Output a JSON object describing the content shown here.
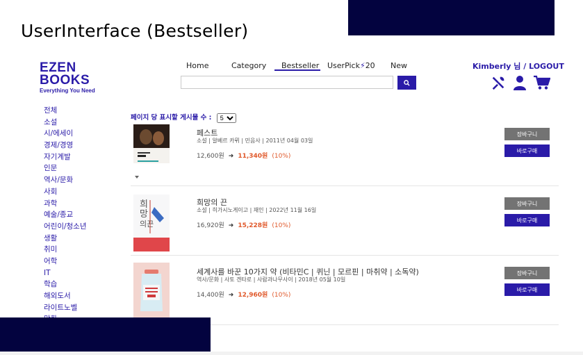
{
  "slide": {
    "title": "UserInterface (Bestseller)"
  },
  "logo": {
    "line1": "EZEN",
    "line2": "BOOKS",
    "tagline": "Everything You Need"
  },
  "nav": {
    "home": "Home",
    "category": "Category",
    "bestseller": "Bestseller",
    "userpick_prefix": "UserPick",
    "userpick_suffix": "20",
    "new": "New"
  },
  "search": {
    "value": ""
  },
  "user": {
    "greeting": "Kimberly 님 / LOGOUT"
  },
  "icons": [
    "tools-icon",
    "user-icon",
    "cart-icon",
    "search-icon"
  ],
  "sidebar": {
    "items": [
      "전체",
      "소설",
      "시/에세이",
      "경제/경영",
      "자기계발",
      "인문",
      "역사/문화",
      "사회",
      "과학",
      "예술/종교",
      "어린이/청소년",
      "생활",
      "취미",
      "어학",
      "IT",
      "학습",
      "해외도서",
      "라이트노벨",
      "만화"
    ]
  },
  "per_page": {
    "label": "페이지 당 표시할 게시물 수 :",
    "selected": "5"
  },
  "books": [
    {
      "title": "페스트",
      "meta": "소설 | 알베르 카뮈 | 민음사 | 2011년 04월 03일",
      "list_price": "12,600원",
      "sale_price": "11,340원",
      "discount": "(10%)",
      "cart_label": "장바구니",
      "buy_label": "바로구매"
    },
    {
      "title": "희망의 끈",
      "meta": "소설 | 히가시노게이고 | 재인 | 2022년 11월 16일",
      "list_price": "16,920원",
      "sale_price": "15,228원",
      "discount": "(10%)",
      "cart_label": "장바구니",
      "buy_label": "바로구매"
    },
    {
      "title": "세계사를 바꾼 10가지 약 (비타민C | 퀴닌 | 모르핀 | 마취약 | 소독약)",
      "meta": "역사/문화 | 사토 겐타로 | 사람과나무사이 | 2018년 05월 10일",
      "list_price": "14,400원",
      "sale_price": "12,960원",
      "discount": "(10%)",
      "cart_label": "장바구니",
      "buy_label": "바로구매"
    }
  ],
  "colors": {
    "brand": "#2a1ba8",
    "navy": "#03033f",
    "sale": "#e0592b",
    "cart_button": "#737373"
  }
}
